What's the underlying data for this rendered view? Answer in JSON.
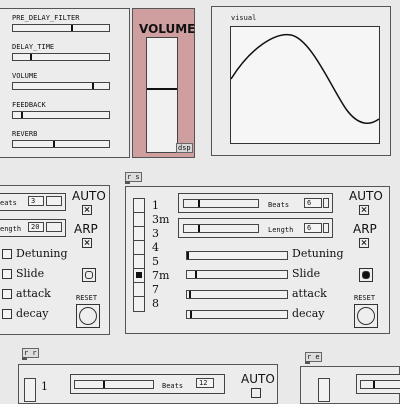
{
  "effects_panel": {
    "params": [
      {
        "label": "PRE_DELAY_FILTER",
        "value": 0.62
      },
      {
        "label": "DELAY_TIME",
        "value": 0.18
      },
      {
        "label": "VOLUME",
        "value": 0.84
      },
      {
        "label": "FEEDBACK",
        "value": 0.08
      },
      {
        "label": "REVERB",
        "value": 0.43
      }
    ],
    "volume_label": "VOLUME",
    "volume_level": 0.55,
    "dsp_label": "dsp",
    "volume_color": "#cf9f9f"
  },
  "visual": {
    "label": "visual"
  },
  "patch_left": {
    "beats_label": "eats",
    "beats_value": "3",
    "length_label": "ength",
    "length_value": "20",
    "auto_label": "AUTO",
    "arp_label": "ARP",
    "detuning_label": "Detuning",
    "slide_label": "Slide",
    "attack_label": "attack",
    "decay_label": "decay",
    "reset_label": "RESET"
  },
  "patch_main": {
    "tag": "r s",
    "steps": [
      "1",
      "3m",
      "3",
      "4",
      "5",
      "7m",
      "7",
      "8"
    ],
    "selected_step": "7m",
    "beats_label": "Beats",
    "beats_value": "6",
    "length_label": "Length",
    "length_value": "6",
    "auto_label": "AUTO",
    "arp_label": "ARP",
    "detuning_label": "Detuning",
    "detuning_value": 0.0,
    "slide_label": "Slide",
    "slide_value": 0.08,
    "attack_label": "attack",
    "attack_value": 0.02,
    "decay_label": "decay",
    "decay_value": 0.03,
    "reset_label": "RESET"
  },
  "patch_bottom_left": {
    "tag": "r r",
    "step_first": "1"
  },
  "patch_bottom_mid": {
    "beats_label": "Beats",
    "beats_value": "12",
    "auto_label": "AUTO"
  },
  "patch_bottom_right": {
    "tag": "r e"
  }
}
